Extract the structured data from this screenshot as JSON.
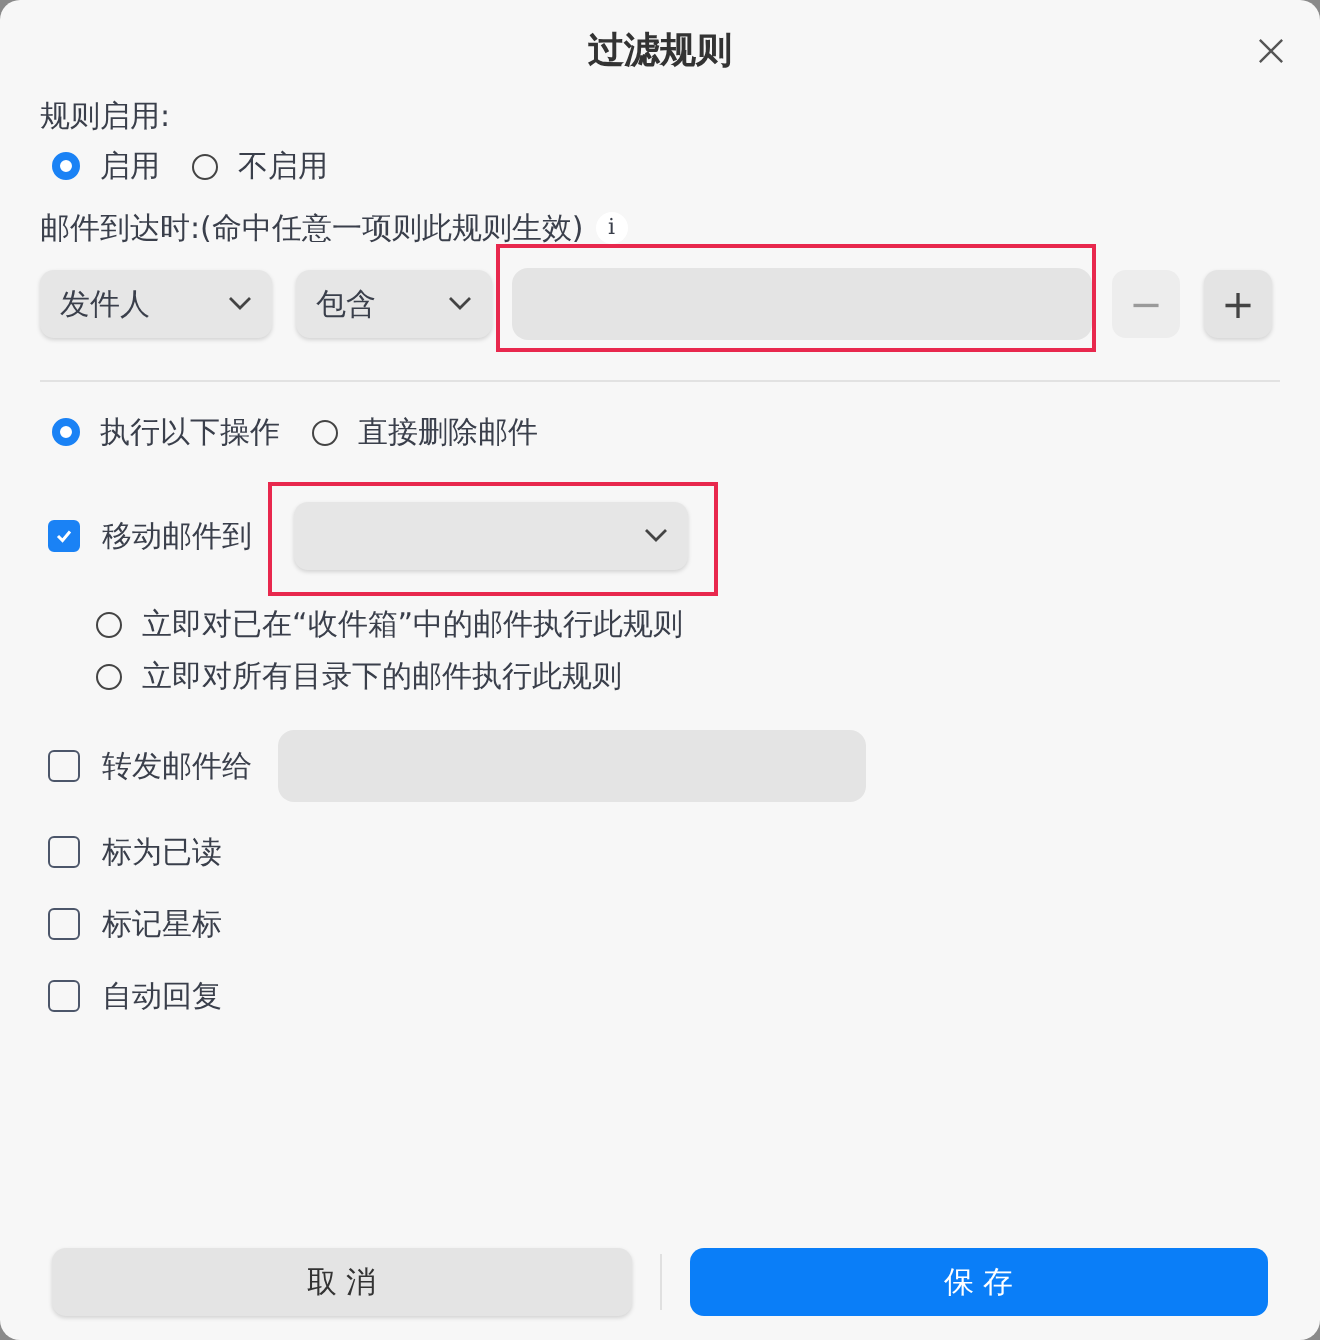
{
  "dialog": {
    "title": "过滤规则"
  },
  "enable": {
    "label": "规则启用:",
    "options": [
      {
        "label": "启用",
        "selected": true
      },
      {
        "label": "不启用",
        "selected": false
      }
    ]
  },
  "condition": {
    "label": "邮件到达时:(命中任意一项则此规则生效)",
    "info": "i",
    "field": "发件人",
    "operator": "包含",
    "keyword": {
      "highlighted": true
    },
    "remove_button": {
      "label": "−",
      "disabled": true
    },
    "add_button": {
      "label": "+",
      "disabled": false
    }
  },
  "mode": {
    "options": [
      {
        "label": "执行以下操作",
        "selected": true
      },
      {
        "label": "直接删除邮件",
        "selected": false
      }
    ]
  },
  "actions": [
    {
      "kind": "move",
      "label": "移动邮件到",
      "checked": true,
      "highlighted": true,
      "sub_options": [
        {
          "label": "立即对已在“收件箱”中的邮件执行此规则",
          "selected": false
        },
        {
          "label": "立即对所有目录下的邮件执行此规则",
          "selected": false
        }
      ]
    },
    {
      "kind": "forward",
      "label": "转发邮件给",
      "checked": false
    },
    {
      "kind": "plain",
      "label": "标为已读",
      "checked": false
    },
    {
      "kind": "plain",
      "label": "标记星标",
      "checked": false
    },
    {
      "kind": "plain",
      "label": "自动回复",
      "checked": false
    }
  ],
  "buttons": [
    {
      "label": "取 消",
      "kind": "secondary"
    },
    {
      "label": "保 存",
      "kind": "primary"
    }
  ]
}
